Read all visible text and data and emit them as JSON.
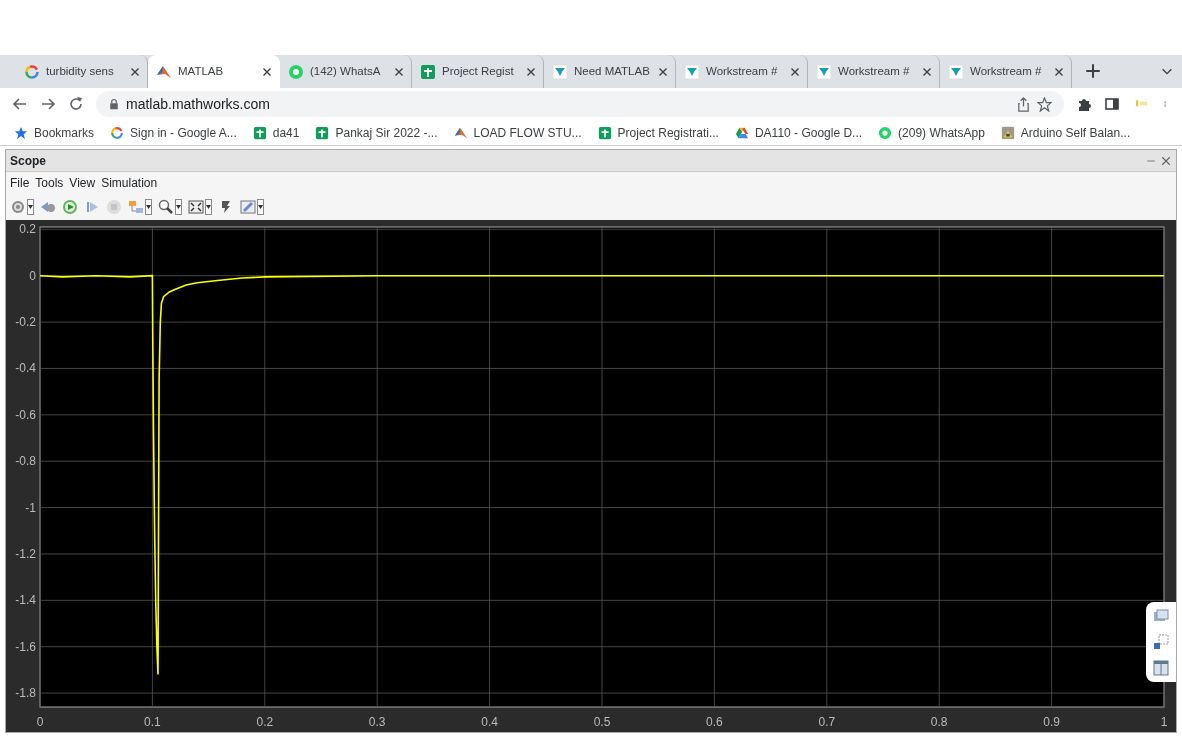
{
  "browser": {
    "tabs": [
      {
        "title": "turbidity sens",
        "kind": "google",
        "selected": false
      },
      {
        "title": "MATLAB",
        "kind": "matlab",
        "selected": true
      },
      {
        "title": "(142) WhatsA",
        "kind": "whatsapp",
        "selected": false
      },
      {
        "title": "Project Regist",
        "kind": "sheets",
        "selected": false
      },
      {
        "title": "Need MATLAB",
        "kind": "workstream",
        "selected": false
      },
      {
        "title": "Workstream #",
        "kind": "workstream",
        "selected": false
      },
      {
        "title": "Workstream #",
        "kind": "workstream",
        "selected": false
      },
      {
        "title": "Workstream #",
        "kind": "workstream",
        "selected": false
      }
    ],
    "address": "matlab.mathworks.com",
    "bookmarks": [
      {
        "label": "Bookmarks",
        "kind": "star"
      },
      {
        "label": "Sign in - Google A...",
        "kind": "google"
      },
      {
        "label": "da41",
        "kind": "sheets"
      },
      {
        "label": "Pankaj Sir 2022 -...",
        "kind": "sheets"
      },
      {
        "label": "LOAD FLOW STU...",
        "kind": "matlab"
      },
      {
        "label": "Project Registrati...",
        "kind": "sheets"
      },
      {
        "label": "DA110 - Google D...",
        "kind": "drive"
      },
      {
        "label": "(209) WhatsApp",
        "kind": "whatsapp"
      },
      {
        "label": "Arduino Self Balan...",
        "kind": "photo"
      }
    ]
  },
  "scope": {
    "title": "Scope",
    "menu": [
      "File",
      "Tools",
      "View",
      "Simulation"
    ],
    "toolbar": [
      {
        "kind": "gear",
        "dropdown": true
      },
      {
        "kind": "step-back",
        "dropdown": false
      },
      {
        "kind": "run",
        "dropdown": false
      },
      {
        "kind": "step-forward",
        "dropdown": false
      },
      {
        "kind": "stop",
        "dropdown": false
      },
      {
        "kind": "highlight",
        "dropdown": true
      },
      {
        "kind": "zoom",
        "dropdown": true
      },
      {
        "kind": "fit",
        "dropdown": true
      },
      {
        "kind": "style",
        "dropdown": false
      },
      {
        "kind": "edit",
        "dropdown": true
      }
    ],
    "chart_data": {
      "type": "line",
      "x": [
        0,
        0.02,
        0.05,
        0.08,
        0.1,
        0.1003,
        0.101,
        0.102,
        0.103,
        0.104,
        0.105,
        0.1055,
        0.106,
        0.107,
        0.108,
        0.11,
        0.115,
        0.12,
        0.13,
        0.14,
        0.16,
        0.18,
        0.2,
        0.3,
        0.5,
        0.7,
        1
      ],
      "series": [
        {
          "color": "#ffff00",
          "values": [
            0,
            -0.005,
            0,
            -0.005,
            0,
            -0.23,
            -0.67,
            -1.1,
            -1.42,
            -1.6,
            -1.72,
            -1.0,
            -0.45,
            -0.2,
            -0.12,
            -0.09,
            -0.07,
            -0.06,
            -0.04,
            -0.03,
            -0.02,
            -0.01,
            -0.005,
            0,
            0,
            0,
            0
          ]
        }
      ],
      "xlim": [
        0,
        1
      ],
      "ylim": [
        -1.86,
        0.21
      ],
      "xticks": [
        0,
        0.1,
        0.2,
        0.3,
        0.4,
        0.5,
        0.6,
        0.7,
        0.8,
        0.9,
        1
      ],
      "yticks": [
        0.2,
        0,
        -0.2,
        -0.4,
        -0.6,
        -0.8,
        -1,
        -1.2,
        -1.4,
        -1.6,
        -1.8
      ],
      "grid": true
    }
  }
}
